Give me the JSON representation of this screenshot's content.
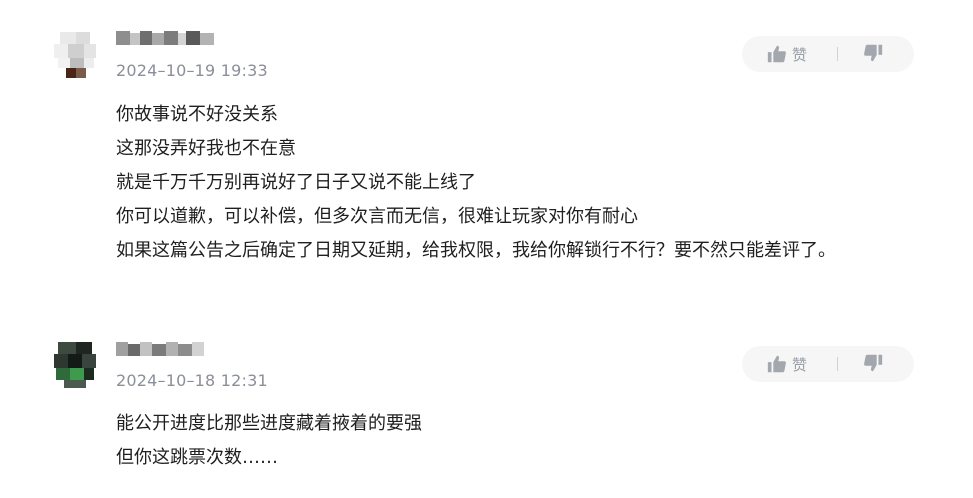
{
  "icons": {
    "like": "thumbs-up-icon",
    "dislike": "thumbs-down-icon"
  },
  "colors": {
    "text": "#1f1f1f",
    "meta": "#8a8f99",
    "pill_bg": "#f6f6f6",
    "icon": "#a3a8ae"
  },
  "comments": [
    {
      "timestamp": "2024–10–19 19:33",
      "like_label": "赞",
      "lines": [
        "你故事说不好没关系",
        "这那没弄好我也不在意",
        "就是千万千万别再说好了日子又说不能上线了",
        "你可以道歉，可以补偿，但多次言而无信，很难让玩家对你有耐心",
        "如果这篇公告之后确定了日期又延期，给我权限，我给你解锁行不行？要不然只能差评了。"
      ]
    },
    {
      "timestamp": "2024–10–18 12:31",
      "like_label": "赞",
      "lines": [
        "能公开进度比那些进度藏着掖着的要强",
        "但你这跳票次数……"
      ]
    }
  ]
}
